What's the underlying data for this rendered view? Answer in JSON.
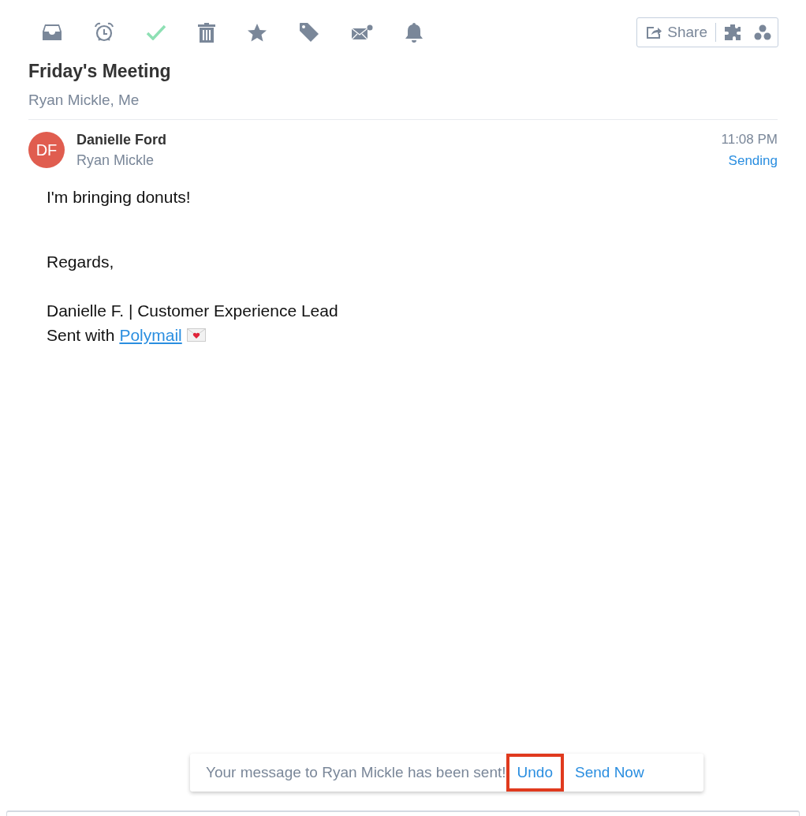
{
  "toolbar": [
    {
      "kind": "inbox"
    },
    {
      "kind": "alarm"
    },
    {
      "kind": "check"
    },
    {
      "kind": "trash"
    },
    {
      "kind": "star"
    },
    {
      "kind": "tag"
    },
    {
      "kind": "mail"
    },
    {
      "kind": "bell"
    }
  ],
  "share": {
    "label": "Share"
  },
  "thread": {
    "title": "Friday's Meeting",
    "participants": "Ryan Mickle, Me"
  },
  "message": {
    "initials": "DF",
    "sender": "Danielle Ford",
    "recipient": "Ryan Mickle",
    "time": "11:08 PM",
    "status": "Sending",
    "body": [
      "I'm bringing donuts!",
      "Regards,",
      "Danielle F. | Customer Experience Lead"
    ],
    "signature_prefix": "Sent with",
    "signature_link": "Polymail"
  },
  "toast": {
    "text": "Your message to Ryan Mickle has been sent!",
    "actions": [
      {
        "label": "Undo",
        "highlighted": true
      },
      {
        "label": "Send Now",
        "highlighted": false
      }
    ]
  }
}
